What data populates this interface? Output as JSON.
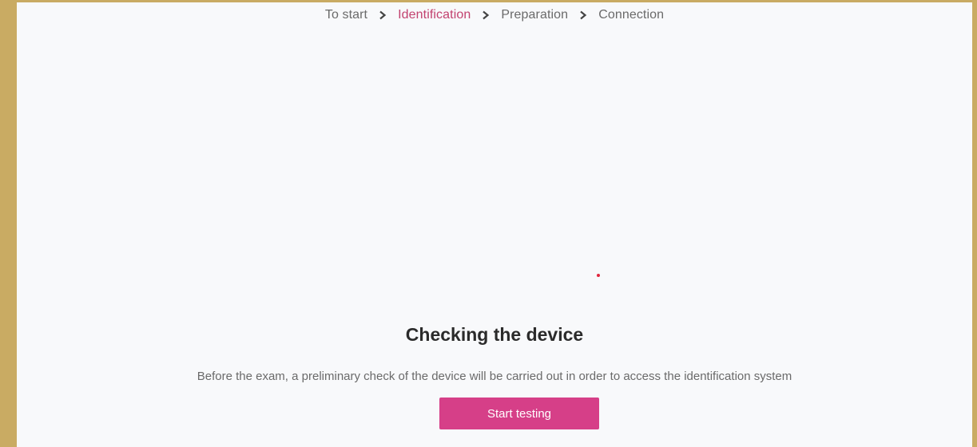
{
  "breadcrumb": {
    "items": [
      {
        "label": "To start",
        "active": false
      },
      {
        "label": "Identification",
        "active": true
      },
      {
        "label": "Preparation",
        "active": false
      },
      {
        "label": "Connection",
        "active": false
      }
    ],
    "separator_icon": "chevron-right-icon"
  },
  "main": {
    "title": "Checking the device",
    "description": "Before the exam, a preliminary check of the device will be carried out in order to access the identification system",
    "start_button_label": "Start testing"
  },
  "colors": {
    "accent": "#d63f88",
    "active_step": "#c2426f",
    "loader_dot": "#e0263d",
    "frame": "#c9ab63",
    "panel_background": "#f8f9fb"
  }
}
